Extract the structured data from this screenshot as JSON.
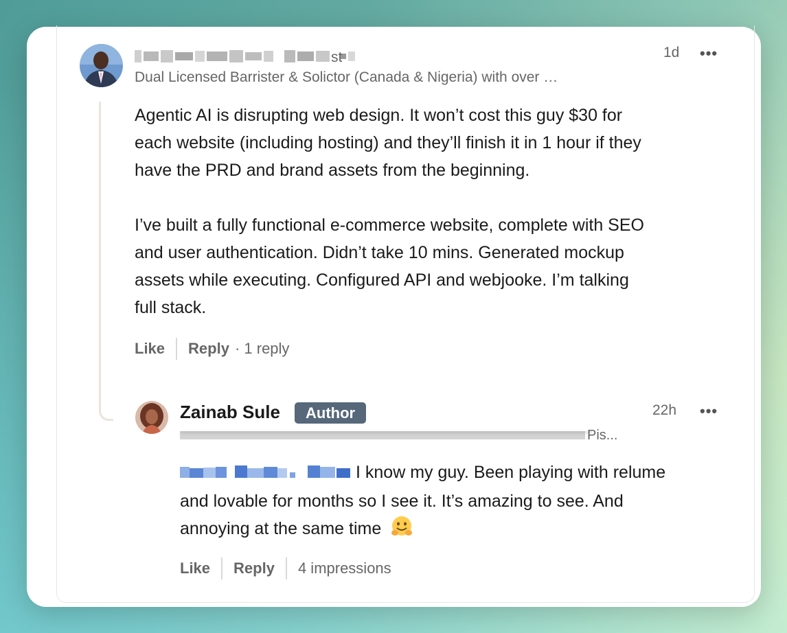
{
  "colors": {
    "accent_badge": "#56687a",
    "text": "#1a1a1a",
    "muted": "#666666",
    "mention": "#3a6fc4"
  },
  "comment": {
    "author_suffix": "st",
    "headline": "Dual Licensed Barrister & Solictor (Canada & Nigeria) with over …",
    "time": "1d",
    "more": "•••",
    "body_p1": "Agentic AI is disrupting web design. It won’t cost this guy $30 for\neach website (including hosting) and they’ll finish it in 1 hour if they\nhave the PRD and brand assets from the beginning.",
    "body_p2": "I’ve built a fully functional e-commerce website, complete with SEO\nand user authentication. Didn’t take 10 mins. Generated mockup\nassets while executing. Configured API and webjooke. I’m talking\nfull stack.",
    "like": "Like",
    "reply": "Reply",
    "reply_count": "· 1 reply"
  },
  "reply": {
    "author": "Zainab Sule",
    "badge": "Author",
    "headline_tail": "Pis...",
    "time": "22h",
    "more": "•••",
    "text_line1": "I know my guy. Been playing with relume",
    "text_line2": "and lovable for months so I see it. It’s amazing to see. And",
    "text_line3": "annoying at the same time",
    "emoji": "hugging-face-icon",
    "like": "Like",
    "reply": "Reply",
    "impressions": "4 impressions"
  }
}
